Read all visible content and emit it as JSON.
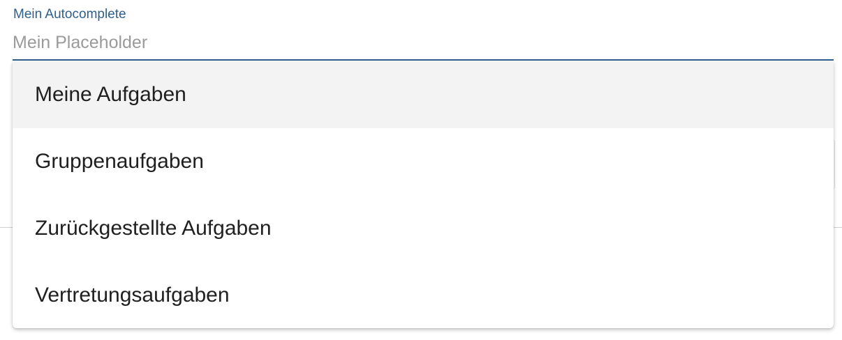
{
  "autocomplete": {
    "label": "Mein Autocomplete",
    "placeholder": "Mein Placeholder",
    "value": "",
    "accent_color": "#2e5f8a",
    "options": [
      {
        "label": "Meine Aufgaben",
        "highlighted": true
      },
      {
        "label": "Gruppenaufgaben",
        "highlighted": false
      },
      {
        "label": "Zurückgestellte Aufgaben",
        "highlighted": false
      },
      {
        "label": "Vertretungsaufgaben",
        "highlighted": false
      }
    ]
  }
}
